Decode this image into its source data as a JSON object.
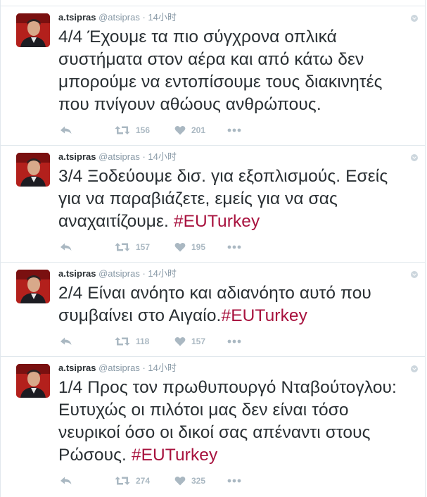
{
  "tweets": [
    {
      "name": "a.tsipras",
      "handle": "@atsipras",
      "dot": "·",
      "time": "14小时",
      "text": "4/4 Έχουμε τα πιο σύγχρονα οπλικά συστήματα στον αέρα και από κάτω δεν μπορούμε να εντοπίσουμε τους διακινητές που πνίγουν αθώους ανθρώπους.",
      "hashtag": "",
      "retweets": "156",
      "likes": "201"
    },
    {
      "name": "a.tsipras",
      "handle": "@atsipras",
      "dot": "·",
      "time": "14小时",
      "text": "3/4 Ξοδεύουμε δισ. για εξοπλισμούς. Εσείς για να παραβιάζετε, εμείς για να σας αναχαιτίζουμε. ",
      "hashtag": "#EUTurkey",
      "retweets": "157",
      "likes": "195"
    },
    {
      "name": "a.tsipras",
      "handle": "@atsipras",
      "dot": "·",
      "time": "14小时",
      "text": "2/4 Είναι ανόητο και αδιανόητο αυτό που συμβαίνει στο Αιγαίο.",
      "hashtag": "#EUTurkey",
      "retweets": "118",
      "likes": "157"
    },
    {
      "name": "a.tsipras",
      "handle": "@atsipras",
      "dot": "·",
      "time": "14小时",
      "text": "1/4 Προς τον πρωθυπουργό Νταβούτογλου: Ευτυχώς οι πιλότοι μας δεν είναι τόσο νευρικοί όσο οι δικοί σας απέναντι στους Ρώσους. ",
      "hashtag": "#EUTurkey",
      "retweets": "274",
      "likes": "325"
    }
  ],
  "icons": {
    "reply": "reply-icon",
    "retweet": "retweet-icon",
    "like": "heart-icon",
    "more": "more-icon",
    "caret": "chevron-down-icon"
  },
  "colors": {
    "hashtag": "#a8123e",
    "text": "#292f33",
    "meta": "#8899a6",
    "action": "#aab8c2",
    "avatar_bg": "#b3201c"
  }
}
